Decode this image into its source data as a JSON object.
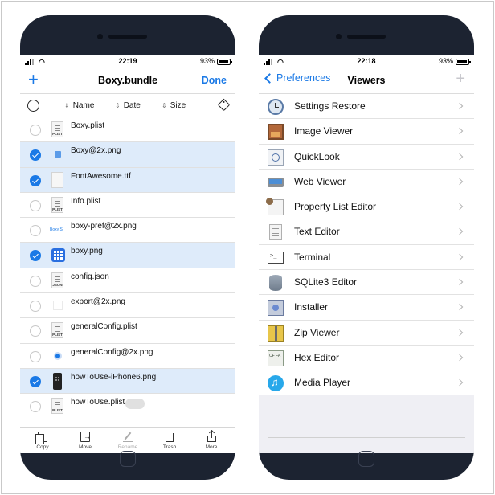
{
  "left_phone": {
    "status": {
      "time": "22:19",
      "battery": "93%"
    },
    "nav": {
      "add": "+",
      "title": "Boxy.bundle",
      "done": "Done"
    },
    "sort": {
      "name": "Name",
      "date": "Date",
      "size": "Size"
    },
    "files": [
      {
        "name": "Boxy.plist",
        "selected": false,
        "icon": "plist-file-icon"
      },
      {
        "name": "Boxy@2x.png",
        "selected": true,
        "icon": "png-thumbnail-icon"
      },
      {
        "name": "FontAwesome.ttf",
        "selected": true,
        "icon": "blank-file-icon"
      },
      {
        "name": "Info.plist",
        "selected": false,
        "icon": "plist-file-icon"
      },
      {
        "name": "boxy-pref@2x.png",
        "selected": false,
        "icon": "png-thumbnail-icon"
      },
      {
        "name": "boxy.png",
        "selected": true,
        "icon": "app-grid-icon"
      },
      {
        "name": "config.json",
        "selected": false,
        "icon": "json-file-icon"
      },
      {
        "name": "export@2x.png",
        "selected": false,
        "icon": "png-thumbnail-icon"
      },
      {
        "name": "generalConfig.plist",
        "selected": false,
        "icon": "plist-file-icon"
      },
      {
        "name": "generalConfig@2x.png",
        "selected": false,
        "icon": "gear-thumbnail-icon"
      },
      {
        "name": "howToUse-iPhone6.png",
        "selected": true,
        "icon": "phone-thumbnail-icon"
      },
      {
        "name": "howToUse.plist",
        "selected": false,
        "icon": "plist-file-icon"
      }
    ],
    "doc_labels": {
      "plist": "PLIST",
      "json": "JSON",
      "pref": "Boxy S"
    },
    "toolbar": {
      "copy": "Copy",
      "move": "Move",
      "rename": "Rename",
      "trash": "Trash",
      "more": "More"
    }
  },
  "right_phone": {
    "status": {
      "time": "22:18",
      "battery": "93%"
    },
    "nav": {
      "back": "Preferences",
      "title": "Viewers",
      "add": "+"
    },
    "viewers": [
      {
        "label": "Settings Restore",
        "icon": "clock-icon"
      },
      {
        "label": "Image Viewer",
        "icon": "image-icon"
      },
      {
        "label": "QuickLook",
        "icon": "quicklook-icon"
      },
      {
        "label": "Web Viewer",
        "icon": "web-icon"
      },
      {
        "label": "Property List Editor",
        "icon": "property-list-icon"
      },
      {
        "label": "Text Editor",
        "icon": "text-document-icon"
      },
      {
        "label": "Terminal",
        "icon": "terminal-icon"
      },
      {
        "label": "SQLite3 Editor",
        "icon": "database-icon"
      },
      {
        "label": "Installer",
        "icon": "installer-icon"
      },
      {
        "label": "Zip Viewer",
        "icon": "zip-icon"
      },
      {
        "label": "Hex Editor",
        "icon": "hex-icon"
      },
      {
        "label": "Media Player",
        "icon": "music-icon"
      }
    ]
  },
  "colors": {
    "accent": "#1a79e6",
    "selected_row": "#deebfa",
    "bezel": "#1c2331"
  }
}
